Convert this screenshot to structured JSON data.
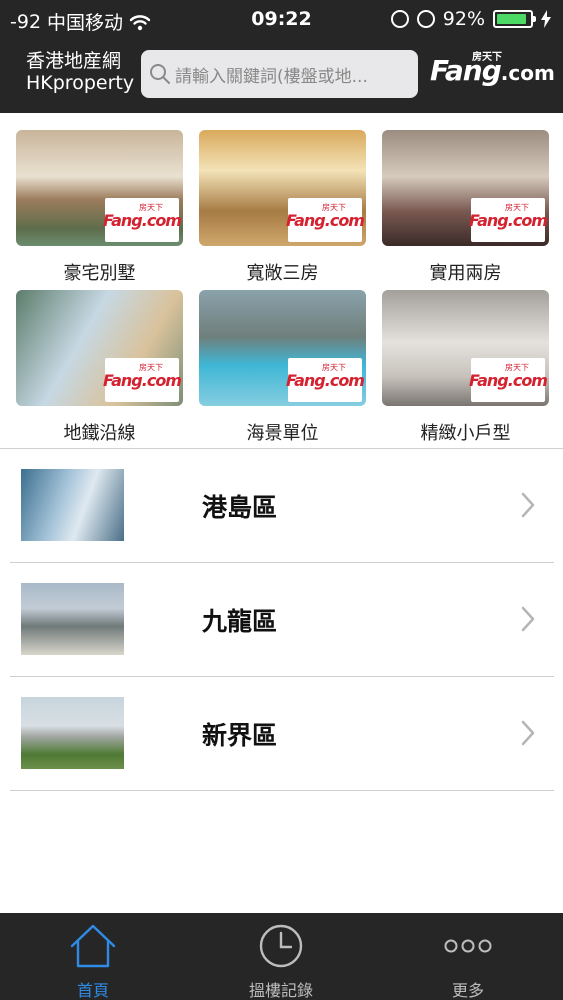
{
  "status": {
    "signal": "-92",
    "carrier": "中国移动",
    "time": "09:22",
    "battery": "92%",
    "battery_level": 0.92
  },
  "header": {
    "brand_cn": "香港地産網",
    "brand_en": "HKproperty",
    "search_placeholder": "請輸入關鍵詞(樓盤或地...",
    "logo_main": "Fang",
    "logo_suffix": ".com",
    "logo_cn": "房天下"
  },
  "categories": [
    {
      "label": "豪宅別墅"
    },
    {
      "label": "寬敞三房"
    },
    {
      "label": "實用兩房"
    },
    {
      "label": "地鐵沿線"
    },
    {
      "label": "海景單位"
    },
    {
      "label": "精緻小戶型"
    }
  ],
  "watermark": {
    "text": "Fang.com",
    "cn": "房天下"
  },
  "regions": [
    {
      "name": "港島區"
    },
    {
      "name": "九龍區"
    },
    {
      "name": "新界區"
    }
  ],
  "tabs": [
    {
      "label": "首頁",
      "active": true,
      "icon": "home-icon"
    },
    {
      "label": "搵樓記錄",
      "active": false,
      "icon": "clock-icon"
    },
    {
      "label": "更多",
      "active": false,
      "icon": "more-icon"
    }
  ],
  "colors": {
    "bar_bg": "#262626",
    "active_tab": "#2f8be6",
    "brand_red": "#d52230",
    "battery_green": "#4cd964"
  }
}
